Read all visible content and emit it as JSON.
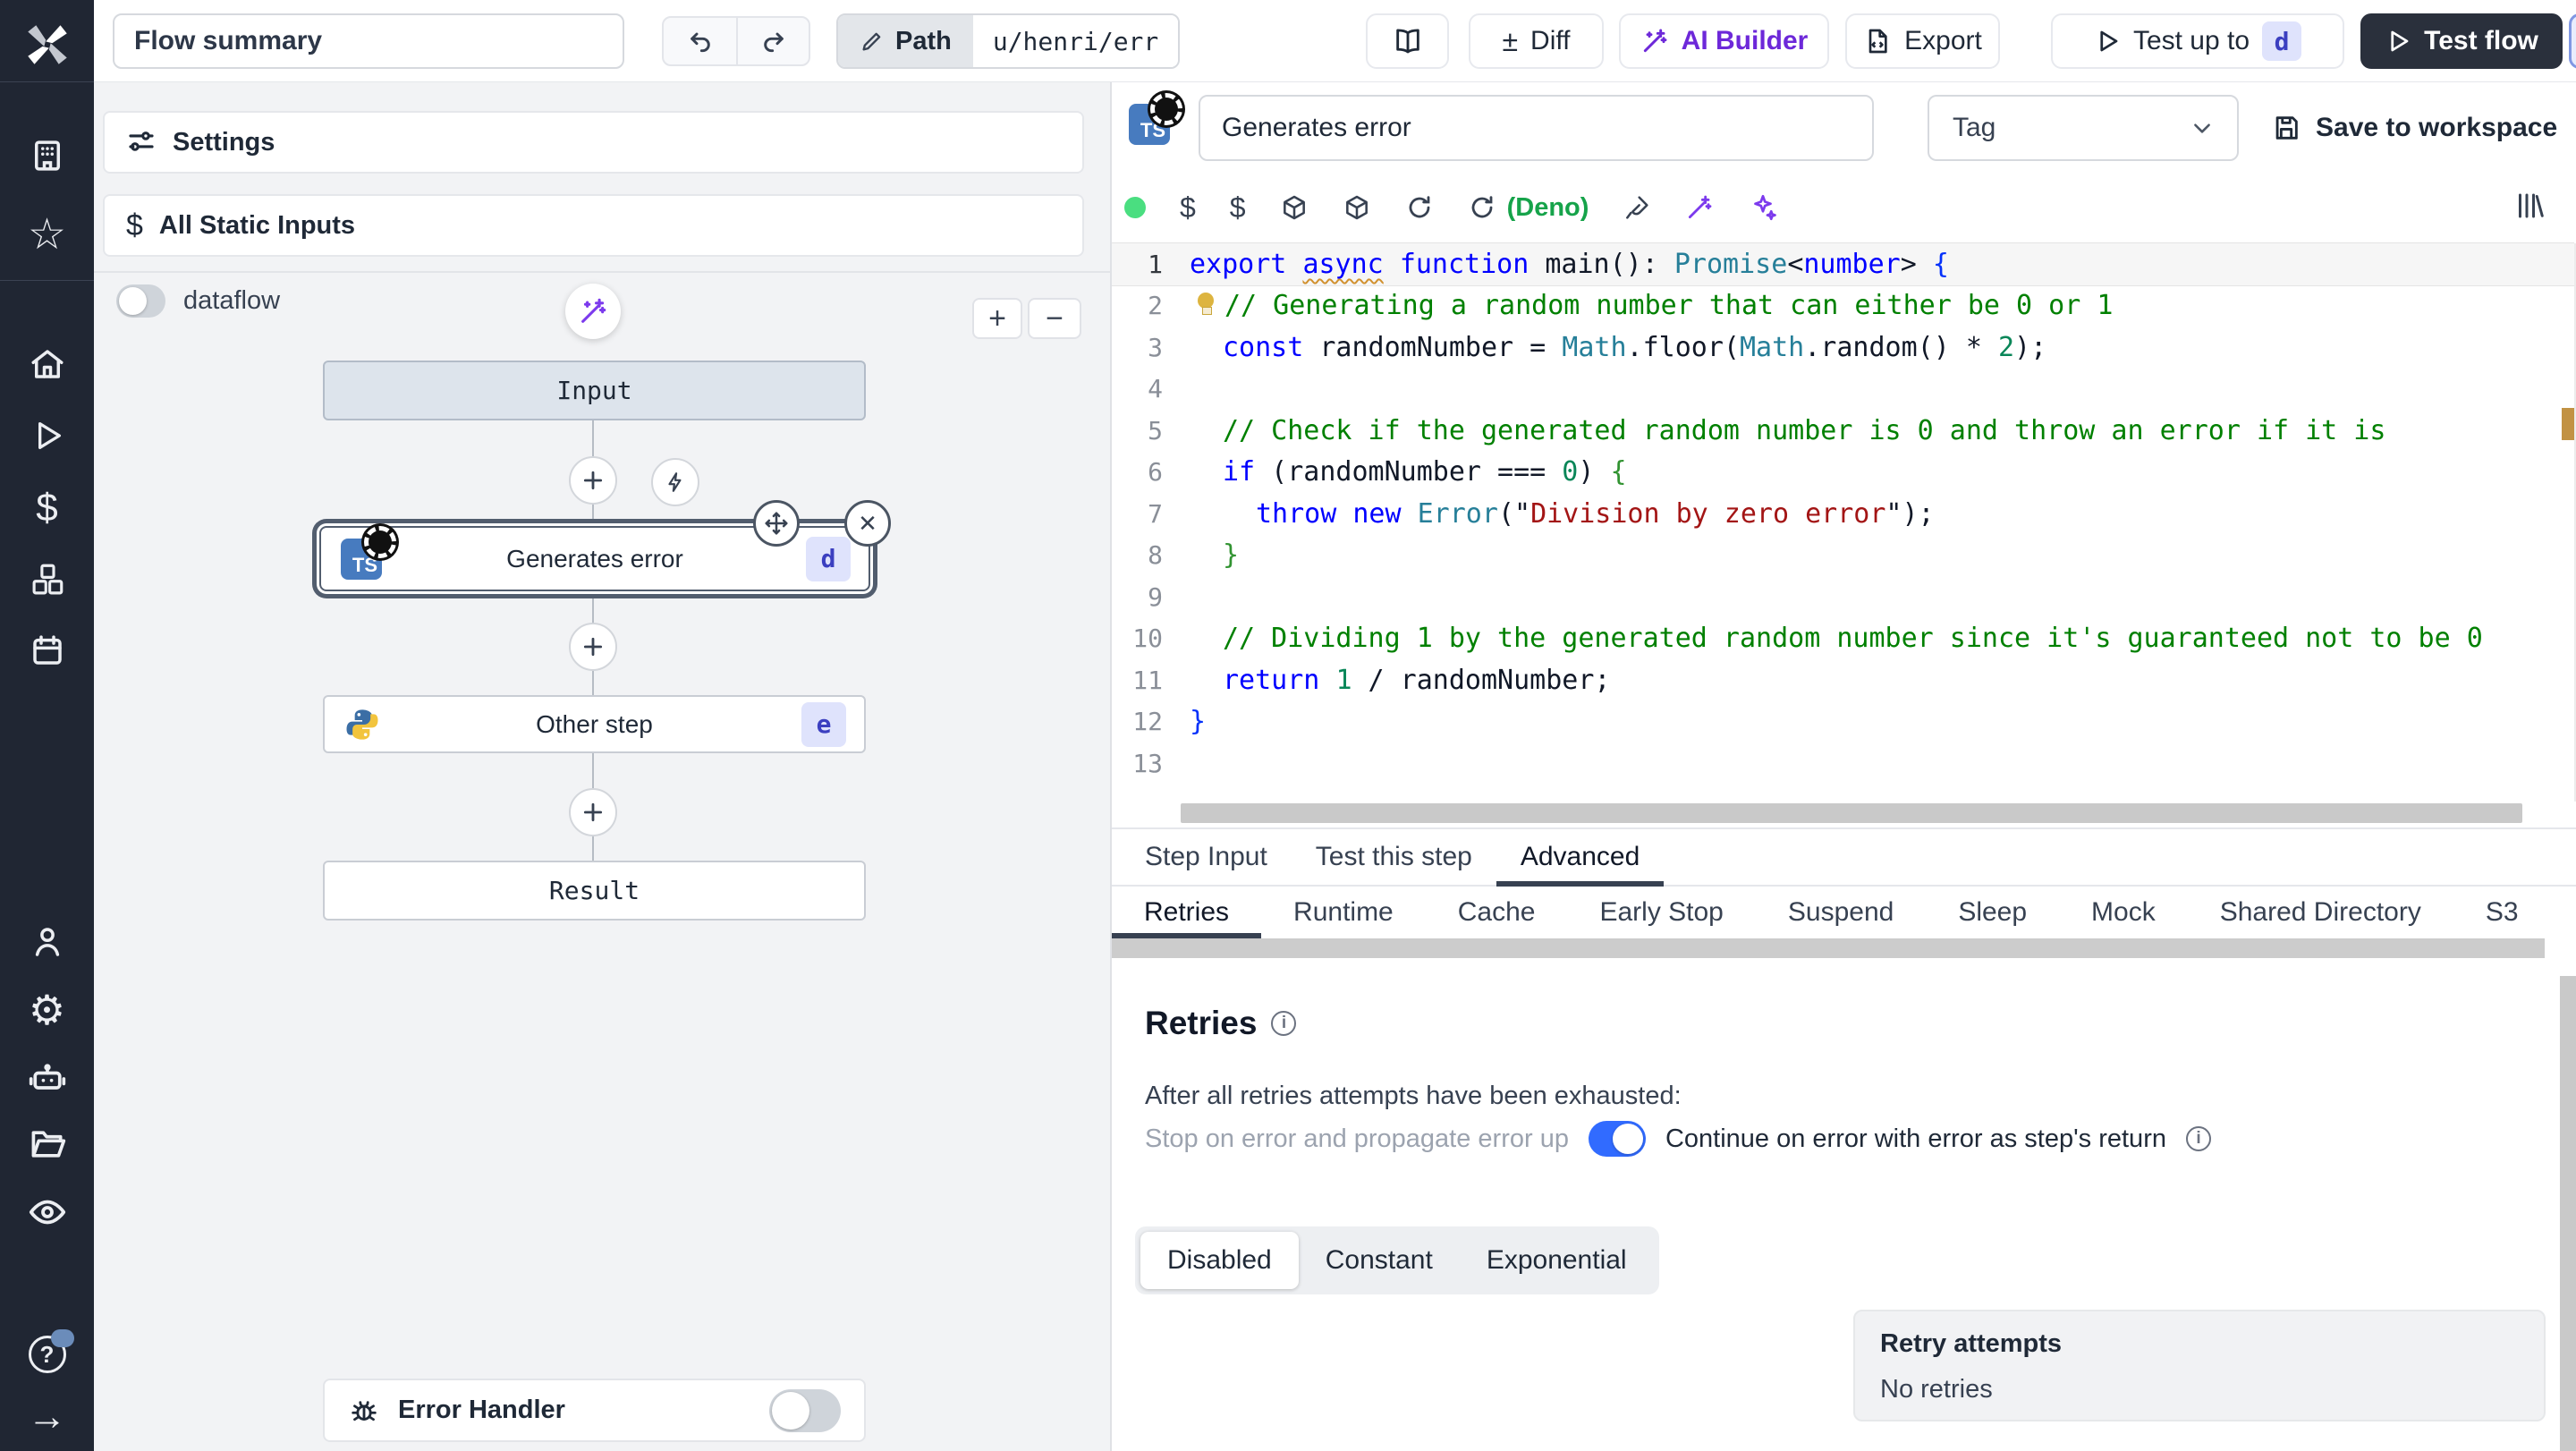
{
  "topbar": {
    "flow_summary": "Flow summary",
    "path_label": "Path",
    "path_value": "u/henri/err",
    "diff_label": "Diff",
    "ai_builder_label": "AI Builder",
    "export_label": "Export",
    "test_up_to_label": "Test up to",
    "test_up_to_badge": "d",
    "test_flow_label": "Test flow"
  },
  "sidebar": {
    "icons": [
      "windmill-logo",
      "building",
      "star",
      "home",
      "play",
      "dollar",
      "cubes",
      "calendar",
      "user",
      "gear",
      "robot",
      "folder",
      "eye",
      "help",
      "arrow-right"
    ],
    "help_has_notification": true
  },
  "flow_panel": {
    "settings_label": "Settings",
    "static_inputs_label": "All Static Inputs",
    "dataflow_label": "dataflow",
    "zoom_in_label": "+",
    "zoom_out_label": "−",
    "nodes": {
      "input": {
        "label": "Input"
      },
      "step_d": {
        "label": "Generates error",
        "badge": "d",
        "lang": "typescript",
        "icon": "TS"
      },
      "step_e": {
        "label": "Other step",
        "badge": "e",
        "lang": "python"
      },
      "result": {
        "label": "Result"
      }
    },
    "error_handler_label": "Error Handler"
  },
  "editor": {
    "ts_badge": "TS",
    "step_name": "Generates error",
    "tag_placeholder": "Tag",
    "save_label": "Save to workspace",
    "deno_label": "(Deno)",
    "code": {
      "lines": [
        {
          "n": 1,
          "indent": 0,
          "active": true,
          "tokens": [
            [
              "k",
              "export"
            ],
            [
              "d",
              " "
            ],
            [
              "k sq",
              "async"
            ],
            [
              "d",
              " "
            ],
            [
              "k",
              "function"
            ],
            [
              "d",
              " main(): "
            ],
            [
              "t",
              "Promise"
            ],
            [
              "d",
              "<"
            ],
            [
              "k",
              "number"
            ],
            [
              "d",
              "> "
            ],
            [
              "b",
              "{"
            ]
          ]
        },
        {
          "n": 2,
          "indent": 1,
          "bulb": true,
          "tokens": [
            [
              "c",
              "// Generating a random number that can either be 0 or 1"
            ]
          ]
        },
        {
          "n": 3,
          "indent": 1,
          "tokens": [
            [
              "k",
              "const"
            ],
            [
              "d",
              " randomNumber = "
            ],
            [
              "t",
              "Math"
            ],
            [
              "d",
              ".floor("
            ],
            [
              "t",
              "Math"
            ],
            [
              "d",
              ".random() * "
            ],
            [
              "n",
              "2"
            ],
            [
              "d",
              ");"
            ]
          ]
        },
        {
          "n": 4,
          "indent": 0,
          "tokens": []
        },
        {
          "n": 5,
          "indent": 1,
          "tokens": [
            [
              "c",
              "// Check if the generated random number is 0 and throw an error if it is"
            ]
          ]
        },
        {
          "n": 6,
          "indent": 1,
          "tokens": [
            [
              "k",
              "if"
            ],
            [
              "d",
              " (randomNumber === "
            ],
            [
              "n",
              "0"
            ],
            [
              "d",
              ") "
            ],
            [
              "g",
              "{"
            ]
          ]
        },
        {
          "n": 7,
          "indent": 2,
          "tokens": [
            [
              "k",
              "throw"
            ],
            [
              "d",
              " "
            ],
            [
              "k",
              "new"
            ],
            [
              "d",
              " "
            ],
            [
              "t",
              "Error"
            ],
            [
              "d",
              "(\""
            ],
            [
              "s",
              "Division by zero error"
            ],
            [
              "d",
              "\");"
            ]
          ]
        },
        {
          "n": 8,
          "indent": 1,
          "tokens": [
            [
              "g",
              "}"
            ]
          ]
        },
        {
          "n": 9,
          "indent": 0,
          "tokens": []
        },
        {
          "n": 10,
          "indent": 1,
          "tokens": [
            [
              "c",
              "// Dividing 1 by the generated random number since it's guaranteed not to be 0"
            ]
          ]
        },
        {
          "n": 11,
          "indent": 1,
          "tokens": [
            [
              "k",
              "return"
            ],
            [
              "d",
              " "
            ],
            [
              "n",
              "1"
            ],
            [
              "d",
              " / randomNumber;"
            ]
          ]
        },
        {
          "n": 12,
          "indent": 0,
          "tokens": [
            [
              "b",
              "}"
            ]
          ]
        },
        {
          "n": 13,
          "indent": 0,
          "tokens": []
        }
      ]
    }
  },
  "panel": {
    "tabs": [
      {
        "label": "Step Input"
      },
      {
        "label": "Test this step"
      },
      {
        "label": "Advanced",
        "active": true
      }
    ],
    "subtabs": [
      {
        "label": "Retries",
        "active": true
      },
      {
        "label": "Runtime"
      },
      {
        "label": "Cache"
      },
      {
        "label": "Early Stop"
      },
      {
        "label": "Suspend"
      },
      {
        "label": "Sleep"
      },
      {
        "label": "Mock"
      },
      {
        "label": "Shared Directory"
      },
      {
        "label": "S3"
      }
    ],
    "retries": {
      "title": "Retries",
      "description": "After all retries attempts have been exhausted:",
      "option_off": "Stop on error and propagate error up",
      "option_on": "Continue on error with error as step's return",
      "toggle_on": true,
      "modes": [
        {
          "label": "Disabled",
          "active": true
        },
        {
          "label": "Constant"
        },
        {
          "label": "Exponential"
        }
      ],
      "summary_title": "Retry attempts",
      "summary_value": "No retries"
    }
  },
  "colors": {
    "accent_blue": "#316bff",
    "purple": "#6d28d9",
    "green": "#16a34a",
    "badge_bg": "#dfe3fc",
    "badge_text": "#3b3fc0",
    "dark_button": "#2a303c",
    "sidebar_bg": "#202633",
    "gold_marker": "#c29243"
  }
}
